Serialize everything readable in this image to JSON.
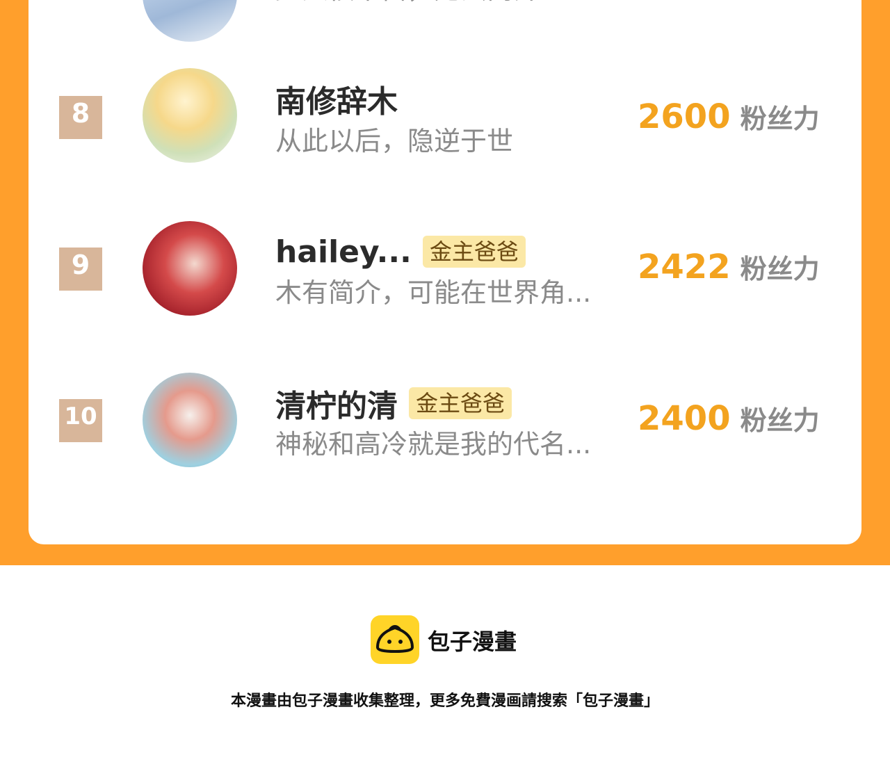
{
  "ranking": {
    "rows": [
      {
        "rank": "",
        "name": "",
        "badge": "",
        "bio": "此人很丰富，无法简介",
        "score": "",
        "unit": ""
      },
      {
        "rank": "8",
        "name": "南修辞木",
        "badge": "",
        "bio": "从此以后，隐逆于世",
        "score": "2600",
        "unit": "粉丝力"
      },
      {
        "rank": "9",
        "name": "hailey...",
        "badge": "金主爸爸",
        "bio": "木有简介，可能在世界角...",
        "score": "2422",
        "unit": "粉丝力"
      },
      {
        "rank": "10",
        "name": "清柠的清",
        "badge": "金主爸爸",
        "bio": "神秘和高冷就是我的代名...",
        "score": "2400",
        "unit": "粉丝力"
      }
    ]
  },
  "footer": {
    "brand": "包子漫畫",
    "notice": "本漫畫由包子漫畫收集整理，更多免費漫画請搜索「包子漫畫」"
  },
  "colors": {
    "accent": "#ff9f2c",
    "score": "#f3a31f",
    "rank_flag": "#d8b69a",
    "badge_bg": "#fbe8a6",
    "logo": "#ffd428"
  }
}
